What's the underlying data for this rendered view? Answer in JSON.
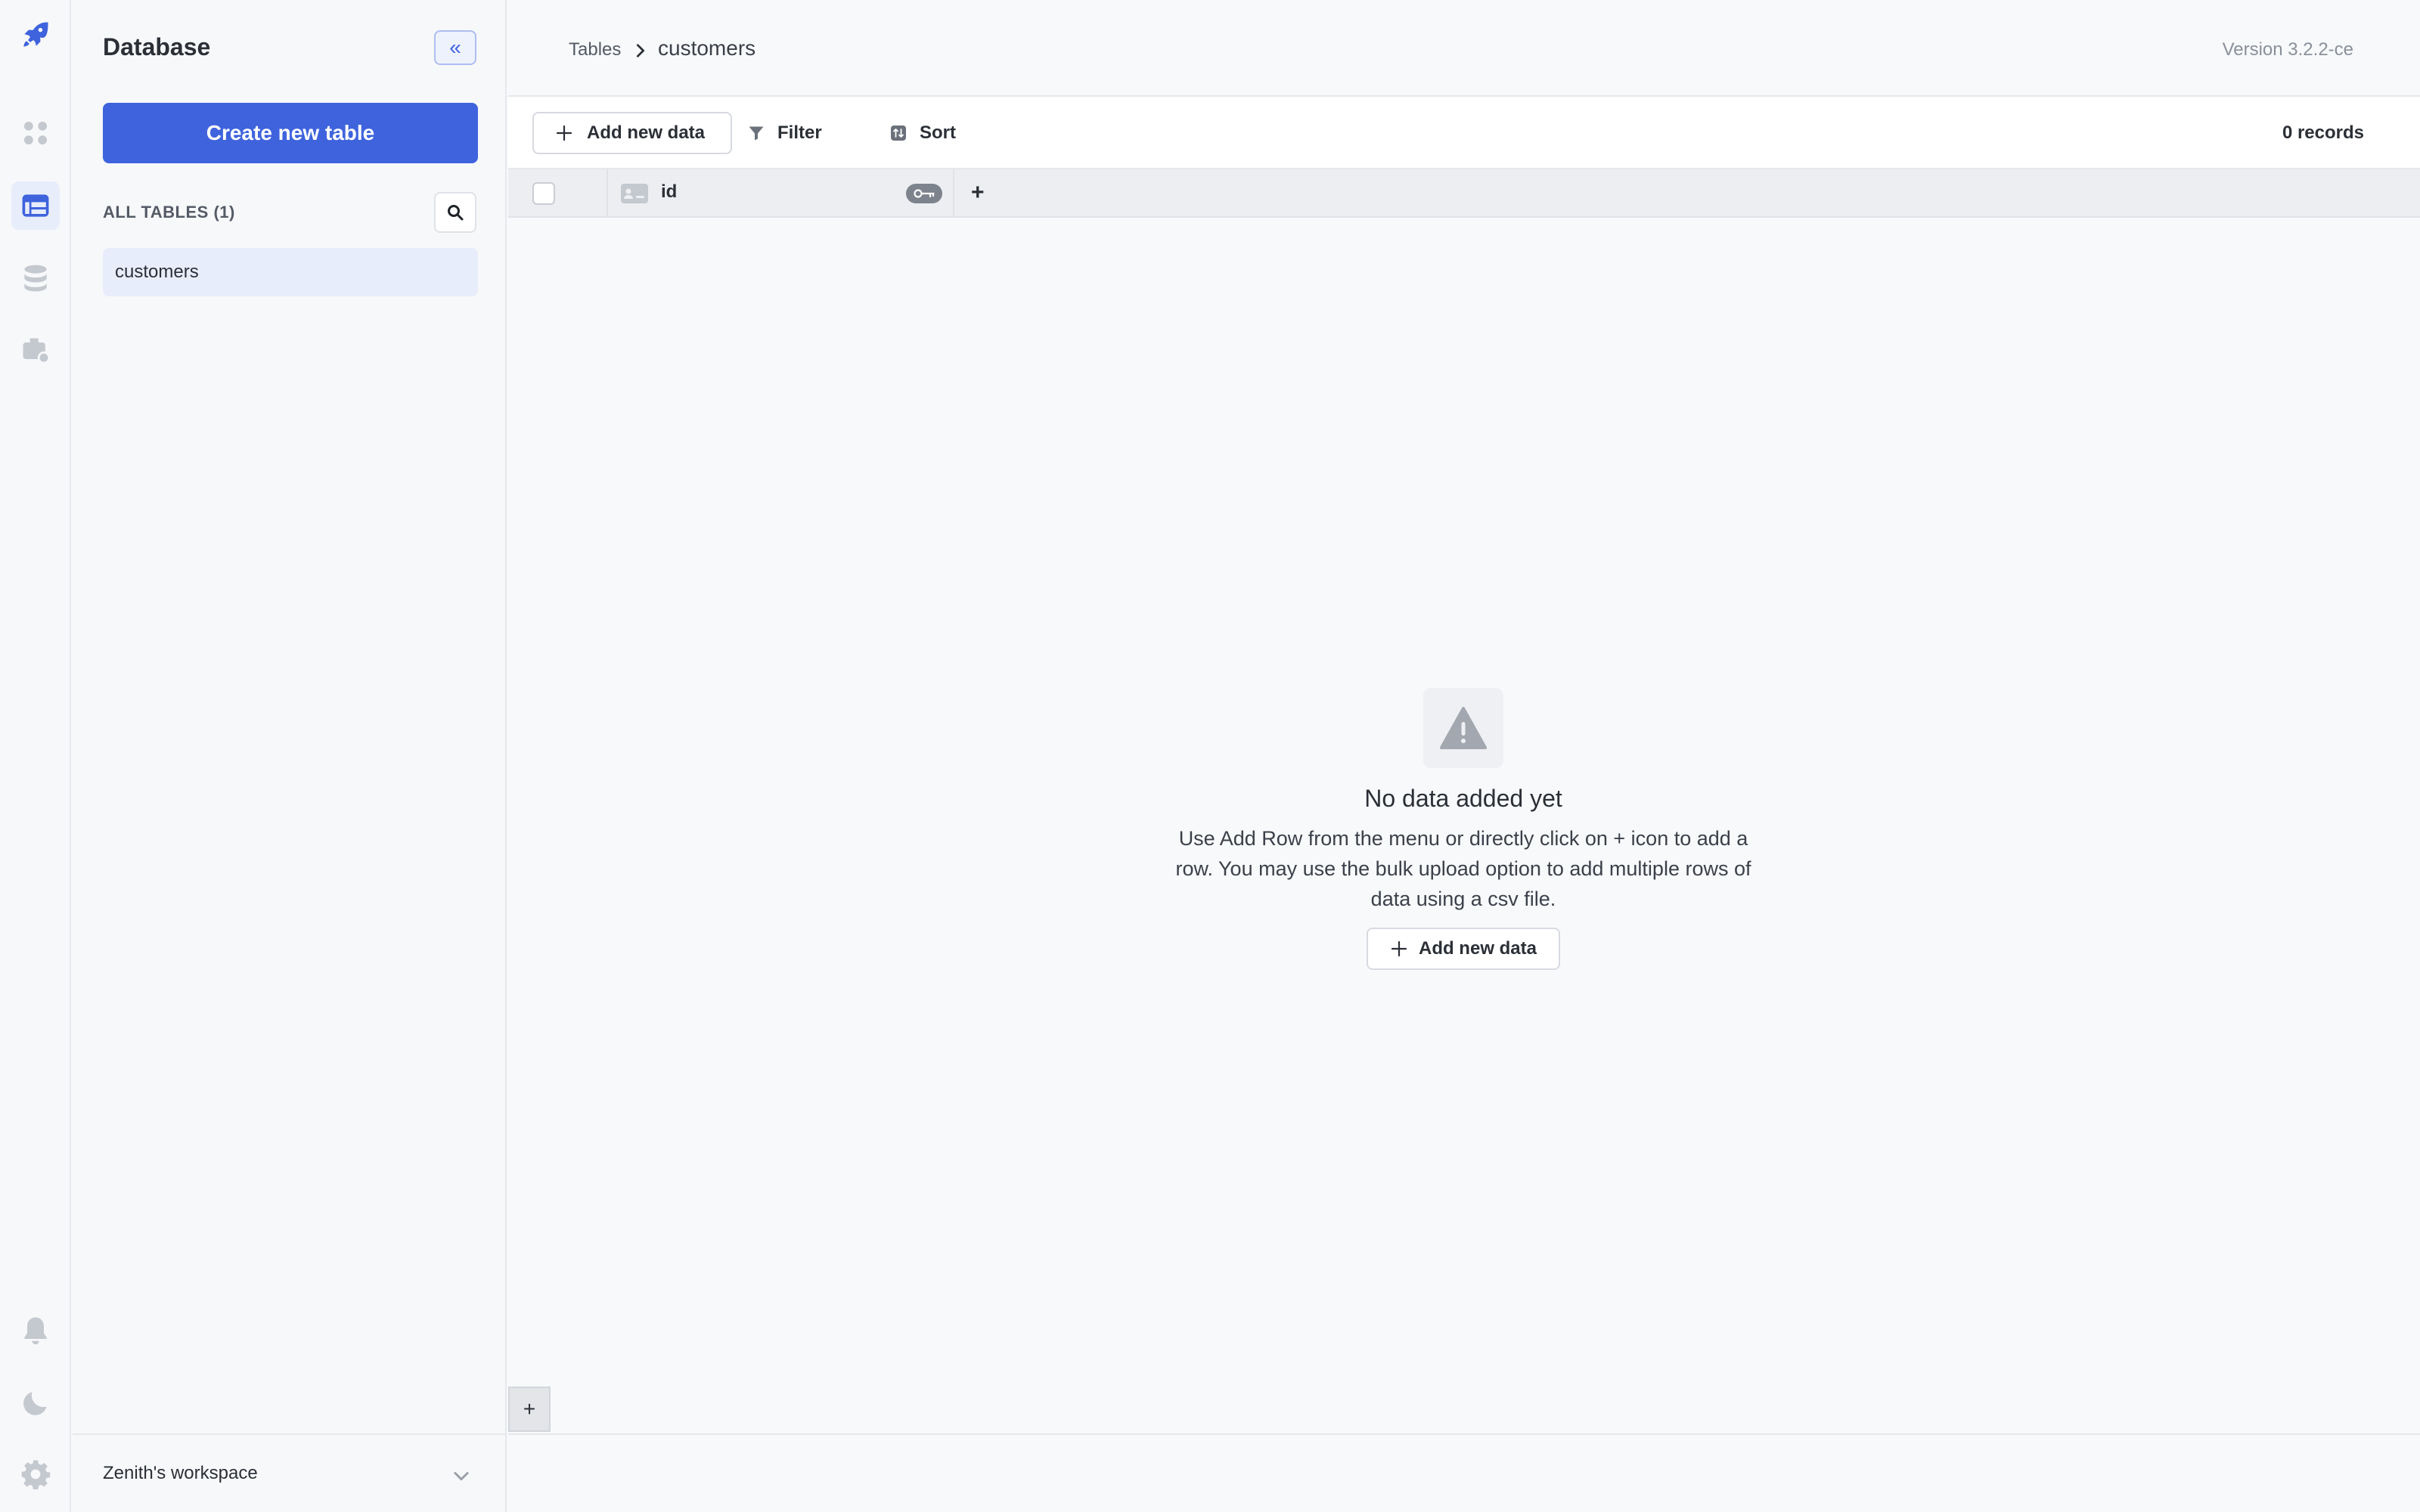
{
  "rail": {
    "icons": [
      "rocket-logo-icon",
      "apps-grid-icon",
      "database-table-icon",
      "data-sources-icon",
      "workflows-icon",
      "bell-icon",
      "moon-icon",
      "gear-icon"
    ],
    "accent": "#3e63dd"
  },
  "sidebar": {
    "title": "Database",
    "collapse_label": "«",
    "create_label": "Create new table",
    "tables_label": "ALL TABLES (1)",
    "tables": [
      {
        "name": "customers",
        "selected": true
      }
    ],
    "workspace": "Zenith's workspace"
  },
  "header": {
    "breadcrumb_root": "Tables",
    "breadcrumb_current": "customers",
    "version": "Version 3.2.2-ce"
  },
  "toolbar": {
    "add_label": "Add new data",
    "filter_label": "Filter",
    "sort_label": "Sort",
    "records": "0 records"
  },
  "grid": {
    "columns": [
      {
        "name": "id",
        "primary_key": true
      }
    ],
    "add_column_label": "+",
    "add_row_label": "+"
  },
  "empty_state": {
    "title": "No data added yet",
    "description": "Use Add Row from the menu or directly click on + icon to add a row. You may use the bulk upload option to add multiple rows of data using a csv file.",
    "button_label": "Add new data"
  }
}
